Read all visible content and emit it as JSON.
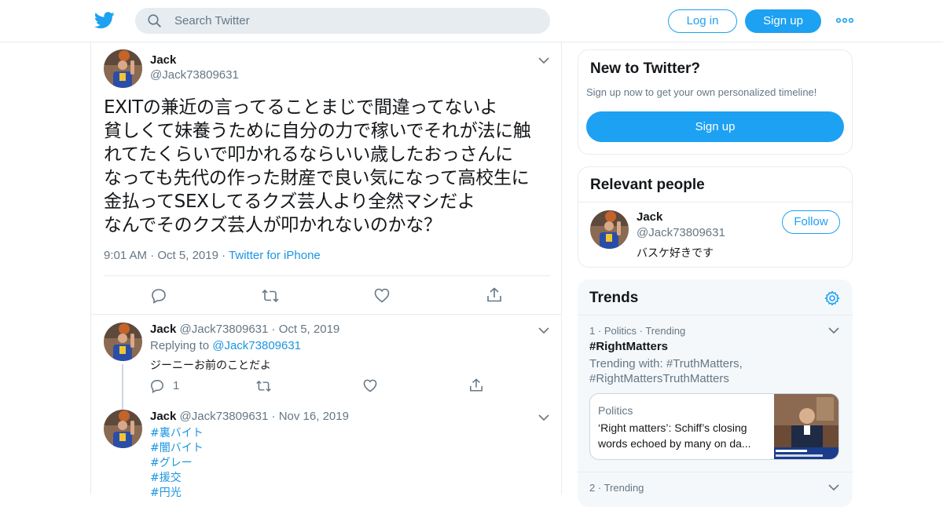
{
  "header": {
    "search_placeholder": "Search Twitter",
    "login_label": "Log in",
    "signup_label": "Sign up"
  },
  "tweet": {
    "name": "Jack",
    "handle": "@Jack73809631",
    "lines": [
      "EXITの兼近の言ってることまじで間違ってないよ",
      "貧しくて妹養うために自分の力で稼いでそれが法に触",
      "れてたくらいで叩かれるならいい歳したおっさんに",
      "なっても先代の作った財産で良い気になって高校生に",
      "金払ってSEXしてるクズ芸人より全然マシだよ",
      "なんでそのクズ芸人が叩かれないのかな？"
    ],
    "time": "9:01 AM",
    "date": "Oct 5, 2019",
    "source": "Twitter for iPhone"
  },
  "replies": [
    {
      "name": "Jack",
      "handle": "@Jack73809631",
      "date": "Oct 5, 2019",
      "replying_prefix": "Replying to",
      "replying_to": "@Jack73809631",
      "text": "ジーニーお前のことだよ",
      "reply_count": "1"
    },
    {
      "name": "Jack",
      "handle": "@Jack73809631",
      "date": "Nov 16, 2019",
      "hashtags": [
        "#裏バイト",
        "#闇バイト",
        "#グレー",
        "#援交",
        "#円光"
      ]
    }
  ],
  "sidebar": {
    "new_to_twitter": {
      "title": "New to Twitter?",
      "subtitle": "Sign up now to get your own personalized timeline!",
      "button": "Sign up"
    },
    "relevant_people": {
      "title": "Relevant people",
      "name": "Jack",
      "handle": "@Jack73809631",
      "bio": "バスケ好きです",
      "follow_label": "Follow"
    },
    "trends": {
      "title": "Trends",
      "items": [
        {
          "rank": "1",
          "category": "Politics",
          "status": "Trending",
          "topic": "#RightMatters",
          "with_label": "Trending with:",
          "with_line1": "#TruthMatters,",
          "with_line2": "#RightMattersTruthMatters",
          "card_category": "Politics",
          "card_title_1": "‘Right matters’: Schiff’s closing",
          "card_title_2": "words echoed by many on da..."
        },
        {
          "rank": "2",
          "status": "Trending"
        }
      ]
    }
  },
  "colors": {
    "accent": "#1da1f2",
    "link": "#1b95e0",
    "muted": "#657786",
    "border": "#e6ecf0",
    "trends_bg": "#f5f8fa"
  },
  "icons": [
    "twitter-bird-icon",
    "search-icon",
    "more-dots-icon",
    "chevron-down-icon",
    "reply-icon",
    "retweet-icon",
    "like-icon",
    "share-icon",
    "gear-icon"
  ]
}
